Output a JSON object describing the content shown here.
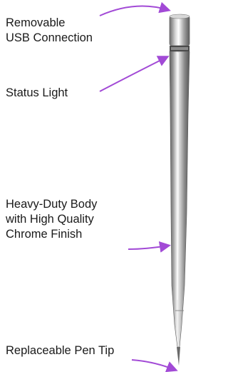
{
  "labels": {
    "usb_connection": "Removable\nUSB Connection",
    "status_light": "Status Light",
    "body": "Heavy-Duty Body\nwith High Quality\nChrome Finish",
    "pen_tip": "Replaceable Pen Tip"
  },
  "colors": {
    "arrow": "#a24ad6",
    "text": "#1a1a1a",
    "chrome_dark": "#6e6e6e",
    "chrome_light": "#f2f2f2"
  }
}
